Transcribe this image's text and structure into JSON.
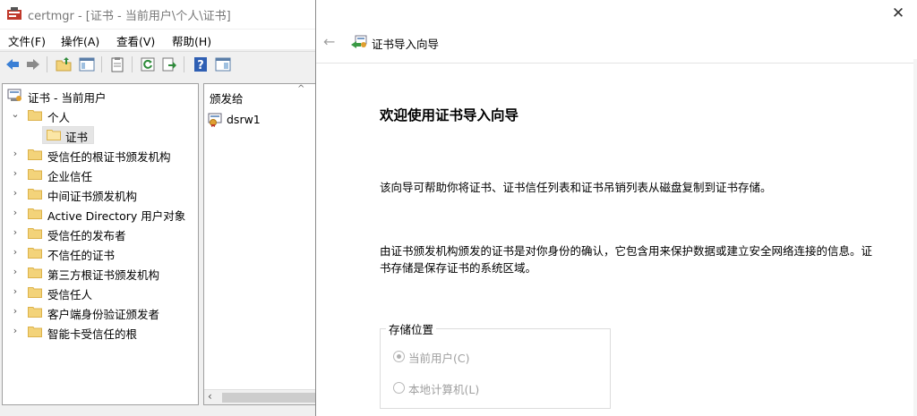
{
  "certmgr": {
    "title": "certmgr - [证书 - 当前用户\\个人\\证书]",
    "menu": [
      "文件(F)",
      "操作(A)",
      "查看(V)",
      "帮助(H)"
    ],
    "tree": {
      "root": "证书 - 当前用户",
      "items": [
        {
          "label": "个人",
          "expanded": true
        },
        {
          "label": "证书",
          "selected": true
        },
        {
          "label": "受信任的根证书颁发机构"
        },
        {
          "label": "企业信任"
        },
        {
          "label": "中间证书颁发机构"
        },
        {
          "label": "Active Directory 用户对象"
        },
        {
          "label": "受信任的发布者"
        },
        {
          "label": "不信任的证书"
        },
        {
          "label": "第三方根证书颁发机构"
        },
        {
          "label": "受信任人"
        },
        {
          "label": "客户端身份验证颁发者"
        },
        {
          "label": "智能卡受信任的根"
        }
      ]
    },
    "list": {
      "column_header": "颁发给",
      "rows": [
        "dsrw1"
      ]
    }
  },
  "wizard": {
    "close_glyph": "✕",
    "back_glyph": "←",
    "header_title": "证书导入向导",
    "heading": "欢迎使用证书导入向导",
    "para1": "该向导可帮助你将证书、证书信任列表和证书吊销列表从磁盘复制到证书存储。",
    "para2": "由证书颁发机构颁发的证书是对你身份的确认，它包含用来保护数据或建立安全网络连接的信息。证书存储是保存证书的系统区域。",
    "store_location": {
      "legend": "存储位置",
      "options": [
        {
          "label": "当前用户(C)",
          "checked": true,
          "enabled": false
        },
        {
          "label": "本地计算机(L)",
          "checked": false,
          "enabled": false
        }
      ]
    }
  },
  "colors": {
    "folder": "#f3d37a",
    "folder_dark": "#dcb24a",
    "selection": "#e5e5e5",
    "disabled_text": "#a0a0a0"
  }
}
